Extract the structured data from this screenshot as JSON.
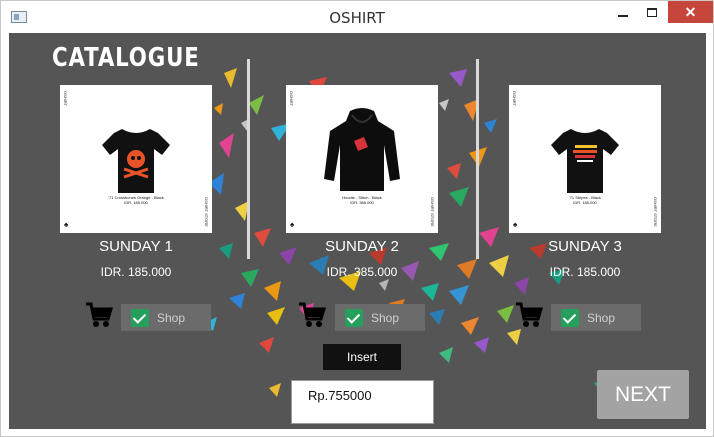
{
  "window": {
    "title": "OSHIRT"
  },
  "window_controls": {
    "minimize": "minimize-icon",
    "maximize": "maximize-icon",
    "close": "✕"
  },
  "page": {
    "heading": "CATALOGUE"
  },
  "products": [
    {
      "name": "SUNDAY 1",
      "price": "IDR. 185.000",
      "shop_label": "Shop",
      "shop_checked": true,
      "image_icon": "tshirt-skull-icon",
      "image_caption": [
        "'71 Crossbones Orange - Black",
        "IDR. 185.000"
      ]
    },
    {
      "name": "SUNDAY 2",
      "price": "IDR. 385.000",
      "shop_label": "Shop",
      "shop_checked": true,
      "image_icon": "hoodie-icon",
      "image_caption": [
        "Hoodie - Stitch - Black",
        "IDR. 385.000"
      ]
    },
    {
      "name": "SUNDAY 3",
      "price": "IDR. 185.000",
      "shop_label": "Shop",
      "shop_checked": true,
      "image_icon": "tshirt-stripes-icon",
      "image_caption": [
        "'71 Stripes - Black",
        "IDR. 185.000"
      ]
    }
  ],
  "image_tags": {
    "top": "OSHIRT",
    "bottom": "OSHIRT STORE"
  },
  "actions": {
    "insert": "Insert",
    "next": "NEXT"
  },
  "total": {
    "value": "Rp.755000"
  },
  "colors": {
    "background": "#555555",
    "shop_check": "#25a05c",
    "close_button": "#c7463b",
    "next_button": "#a3a3a3"
  }
}
